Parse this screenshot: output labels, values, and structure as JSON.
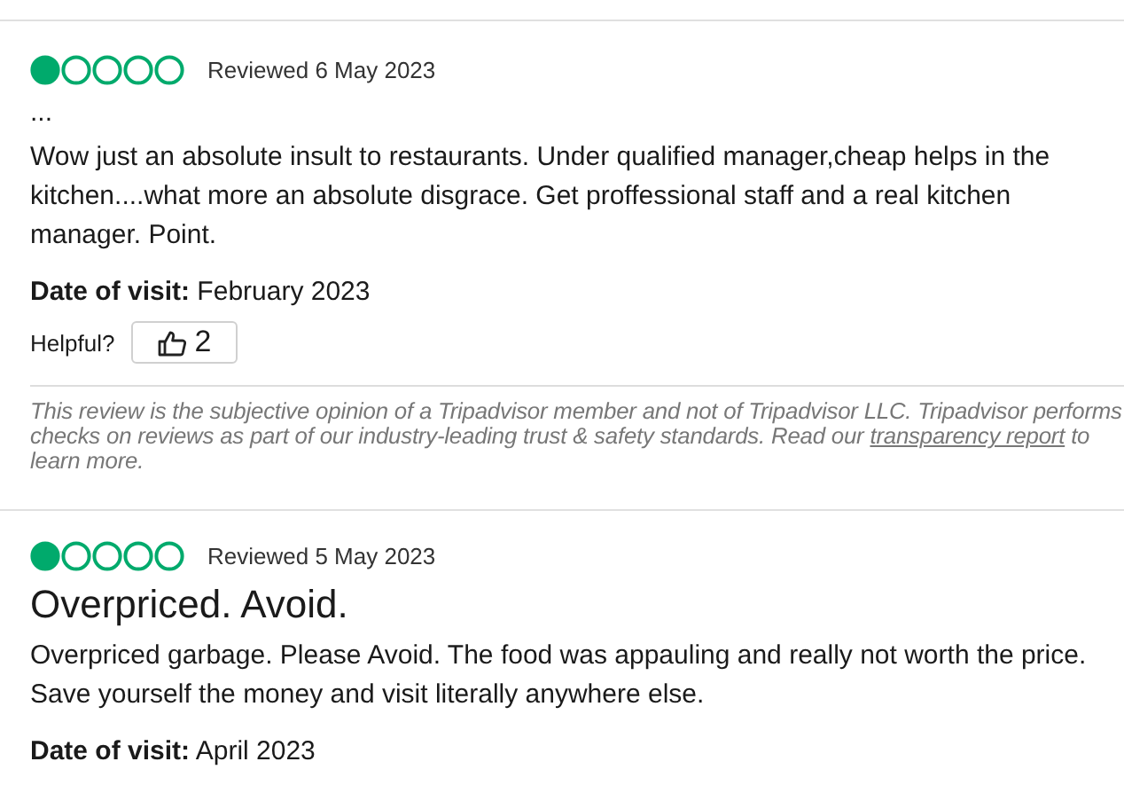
{
  "reviews": [
    {
      "stars": 1,
      "reviewed": "Reviewed 6 May 2023",
      "title": "...",
      "kind": "small",
      "body": "Wow just an absolute insult to restaurants. Under qualified manager,cheap helps in the kitchen....what more an absolute disgrace. Get proffessional staff and a real kitchen manager. Point.",
      "visit_label": "Date of visit:",
      "visit_date": "February 2023",
      "helpful_label": "Helpful?",
      "helpful_count": "2",
      "disclaimer": "This review is the subjective opinion of a Tripadvisor member and not of Tripadvisor LLC. Tripadvisor performs checks on reviews as part of our industry-leading trust & safety standards. Read our",
      "disclaimer_link": "transparency report",
      "disclaimer_end": "to learn more."
    },
    {
      "stars": 1,
      "reviewed": "Reviewed 5 May 2023",
      "title": "Overpriced. Avoid.",
      "kind": "large",
      "body": "Overpriced garbage. Please Avoid. The food was appauling and really not worth the price. Save yourself the money and visit literally anywhere else.",
      "visit_label": "Date of visit:",
      "visit_date": "April 2023"
    }
  ]
}
